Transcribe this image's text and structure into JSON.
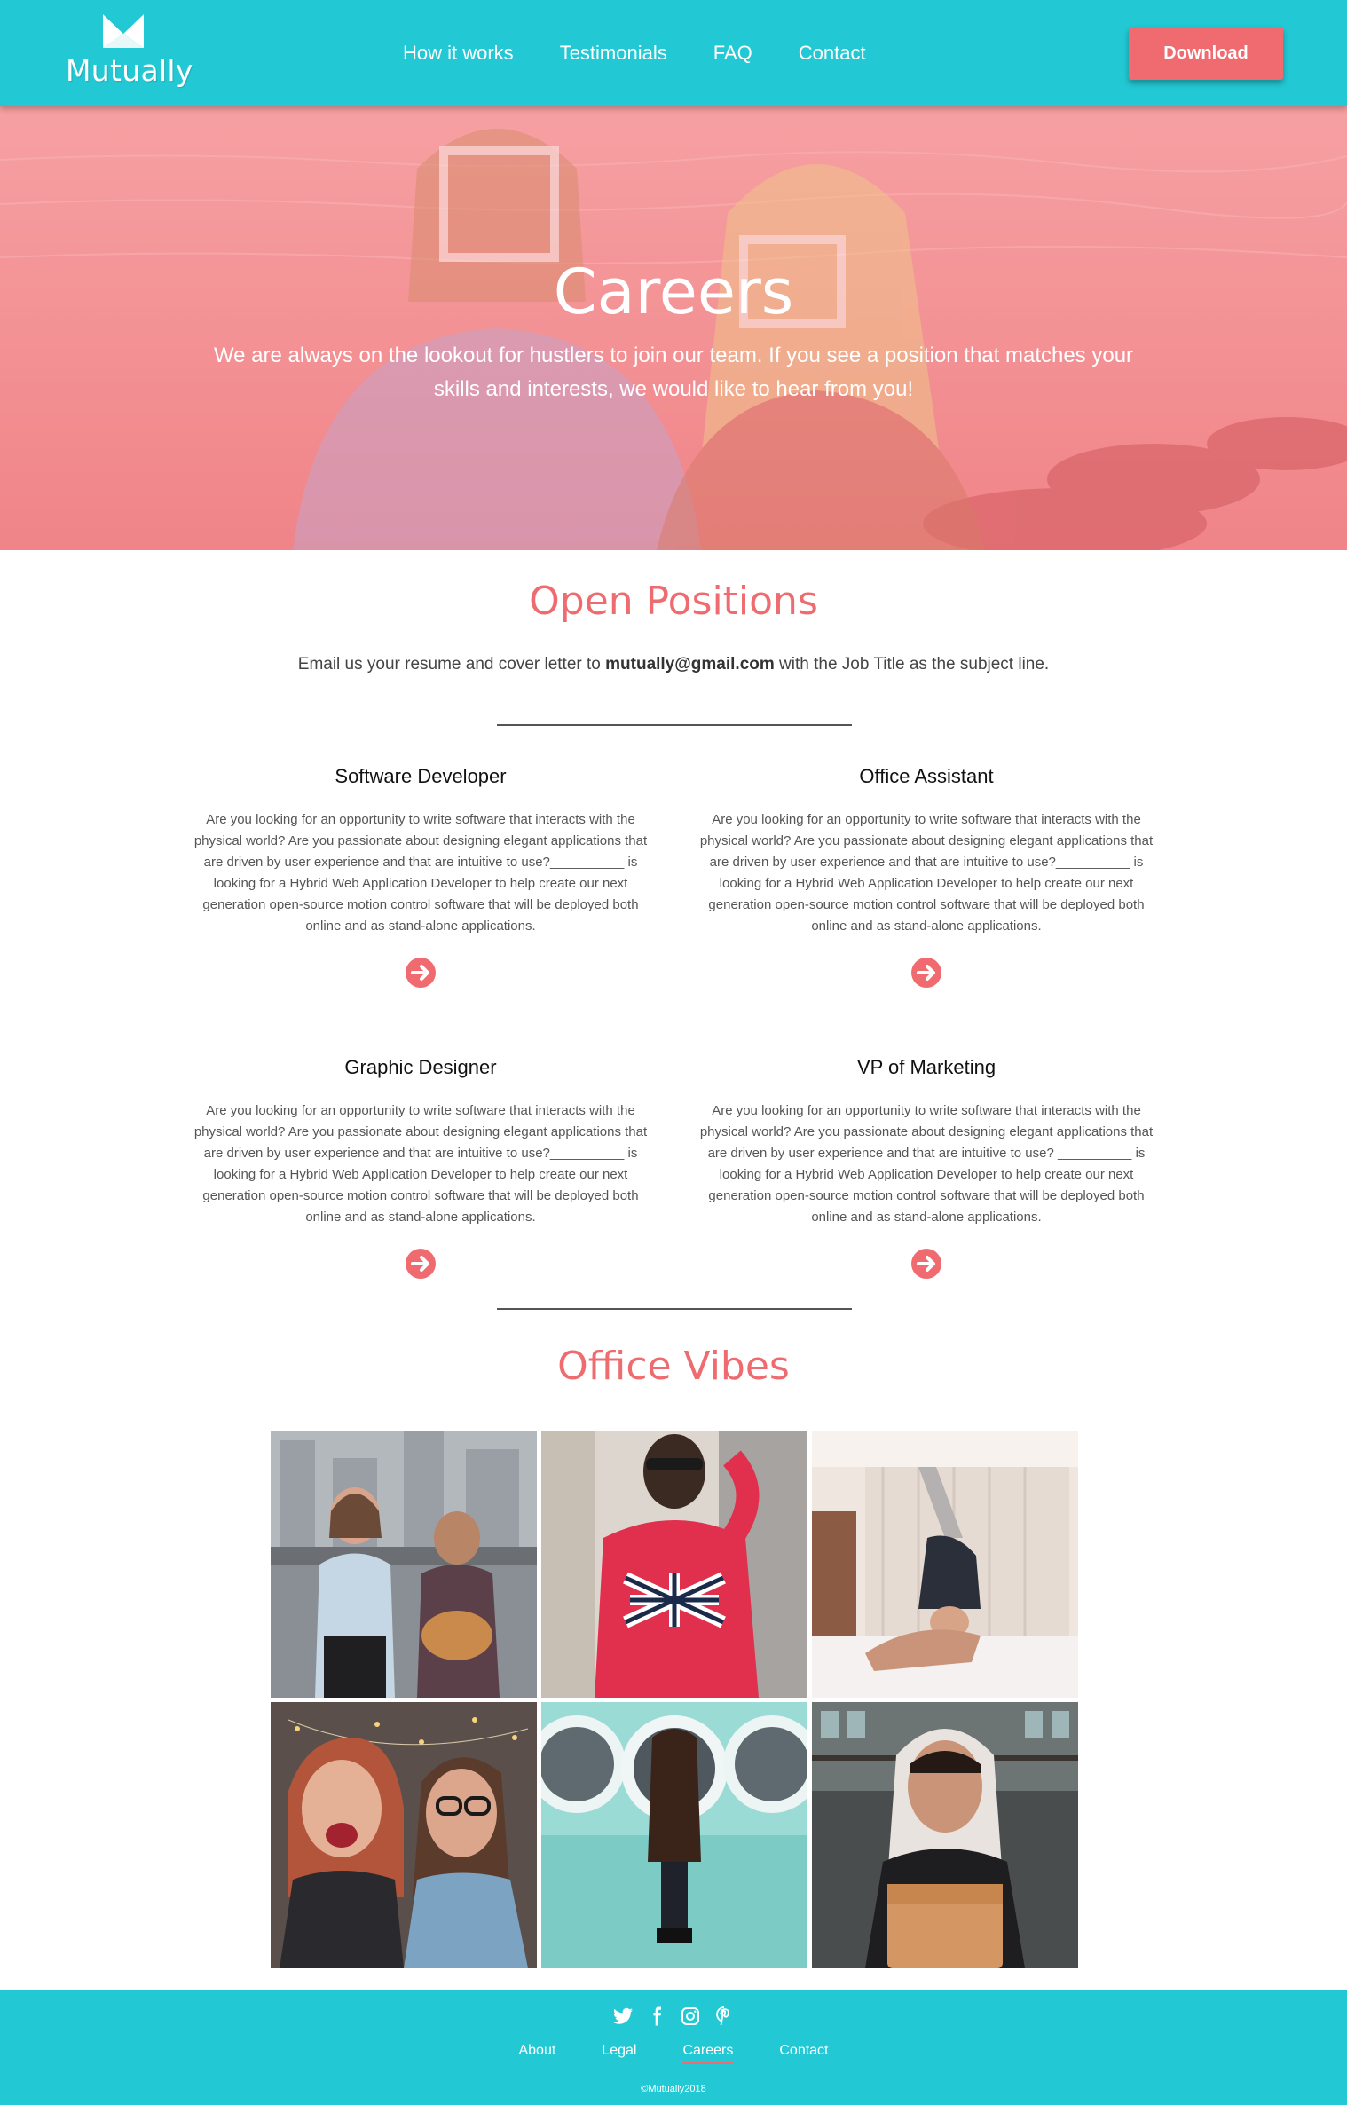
{
  "brand": {
    "name": "Mutually"
  },
  "nav": {
    "items": [
      {
        "label": "How it works"
      },
      {
        "label": "Testimonials"
      },
      {
        "label": "FAQ"
      },
      {
        "label": "Contact"
      }
    ],
    "download_label": "Download"
  },
  "hero": {
    "title": "Careers",
    "text": "We are always on the lookout for hustlers to join our team. If you see a position that matches your skills and interests, we would like to hear from you!"
  },
  "positions": {
    "title": "Open Positions",
    "intro_before": "Email us your resume and cover letter to ",
    "email": "mutually@gmail.com",
    "intro_after": " with the Job Title as the subject line.",
    "jobs": [
      {
        "title": "Software Developer",
        "description": "Are you looking for an opportunity to write software that interacts with the physical world? Are you passionate about designing elegant applications that are driven by user experience and that are intuitive to use?__________ is looking for a Hybrid Web Application Developer to help create our next generation open-source motion control software that will be deployed both online and as stand-alone applications."
      },
      {
        "title": "Office Assistant",
        "description": "Are you looking for an opportunity to write software that interacts with the physical world? Are you passionate about designing elegant applications that are driven by user experience and that are intuitive to use?__________ is looking for a Hybrid Web Application Developer to help create our next generation open-source motion control software that will be deployed both online and as stand-alone applications."
      },
      {
        "title": "Graphic Designer",
        "description": "Are you looking for an opportunity to write software that interacts with the physical world? Are you passionate about designing elegant applications that are driven by user experience and that are intuitive to use?__________ is looking for a Hybrid Web Application Developer to help create our next generation open-source motion control software that will be deployed both online and as stand-alone applications."
      },
      {
        "title": "VP of Marketing",
        "description": "Are you looking for an opportunity to write software that interacts with the physical world? Are you passionate about designing elegant applications that are driven by user experience and that are intuitive to use? __________ is looking for a Hybrid Web Application Developer to help create our next generation open-source motion control software that will be deployed both online and as stand-alone applications."
      }
    ]
  },
  "office": {
    "title": "Office Vibes"
  },
  "footer": {
    "social": [
      "twitter-icon",
      "facebook-icon",
      "instagram-icon",
      "pinterest-icon"
    ],
    "links": [
      {
        "label": "About"
      },
      {
        "label": "Legal"
      },
      {
        "label": "Careers",
        "active": true
      },
      {
        "label": "Contact"
      }
    ],
    "copyright": "©Mutually2018"
  },
  "colors": {
    "teal": "#22c9d4",
    "coral": "#ef6b70",
    "heading_coral": "#ee6c70"
  }
}
